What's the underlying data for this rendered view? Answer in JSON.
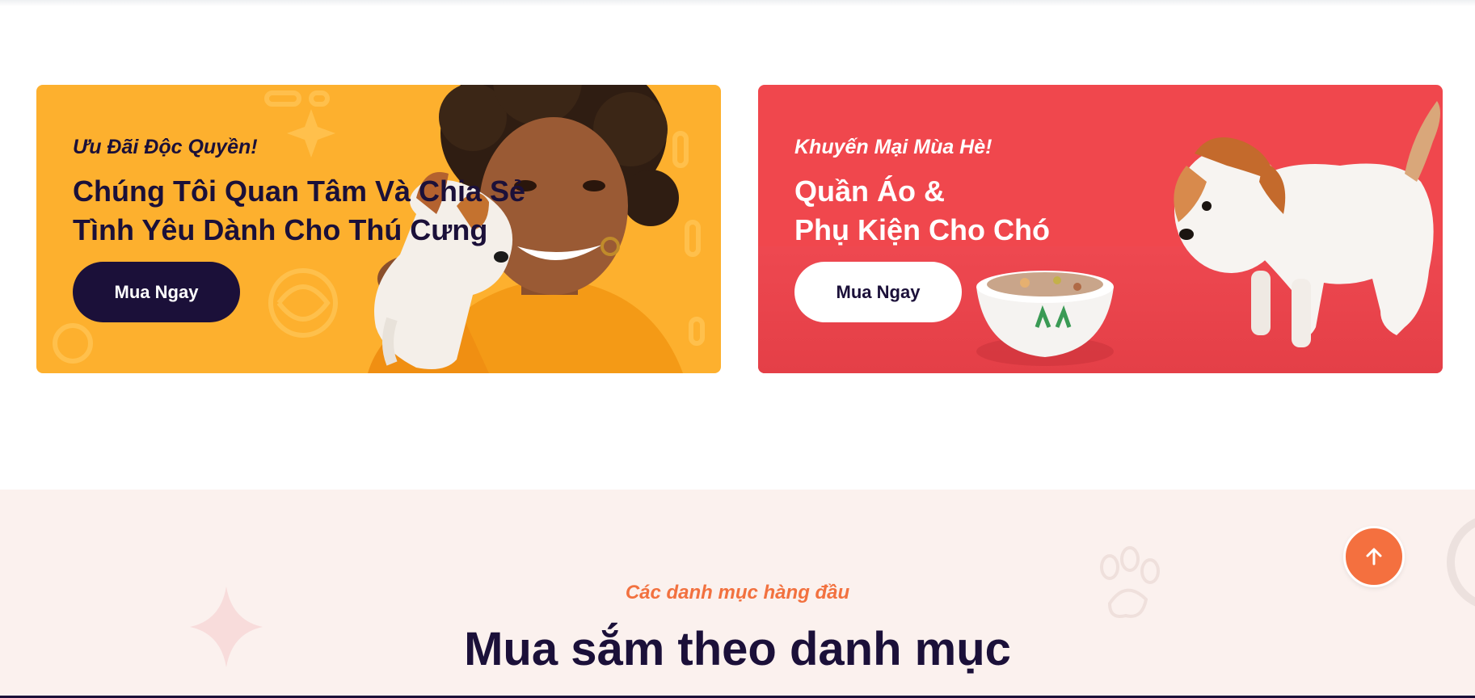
{
  "banners": {
    "left": {
      "subtitle": "Ưu Đãi Độc Quyền!",
      "title_line1": "Chúng Tôi Quan Tâm Và Chia Sẻ",
      "title_line2": "Tình Yêu Dành Cho Thú Cưng",
      "cta_label": "Mua Ngay",
      "bg_color": "#fdb02e"
    },
    "right": {
      "subtitle": "Khuyến Mại Mùa Hè!",
      "title_line1": "Quần Áo &",
      "title_line2": "Phụ Kiện Cho Chó",
      "cta_label": "Mua Ngay",
      "bg_color": "#f0474d"
    }
  },
  "categories": {
    "eyebrow": "Các danh mục hàng đầu",
    "title": "Mua sắm theo danh mục"
  },
  "colors": {
    "accent": "#f4703f",
    "navy": "#1b1039",
    "section_bg": "#fbf1ee"
  },
  "icons": {
    "scroll_top": "arrow-up-icon"
  }
}
